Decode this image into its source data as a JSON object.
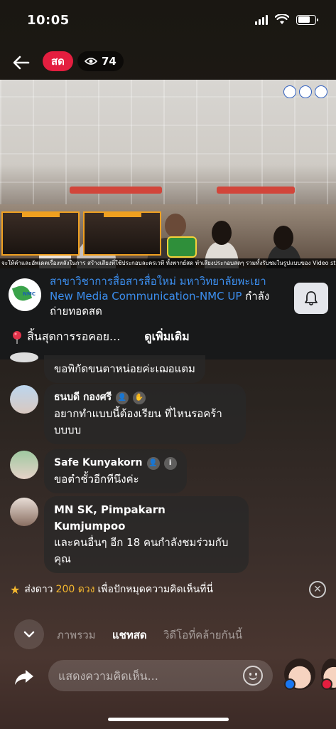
{
  "status_bar": {
    "time": "10:05"
  },
  "header": {
    "live_label": "สด",
    "viewer_count": "74"
  },
  "video": {
    "ticker_text": "จะให้คำและอัพเดตเรื่องหลังในการ สร้างเสียงที่ใช้ประกอบละครเวที ทั้งพากย์สด ทำเสียงประกอบสดๆ รวมทั้งรับชมในรูปแบบของ Video streaming"
  },
  "page_info": {
    "page_name": "สาขาวิชาการสื่อสารสื่อใหม่ มหาวิทยาลัยพะเยา New Media Communication-NMC UP",
    "suffix": " กำลังถ่ายทอดสด",
    "avatar_text": "NMC",
    "status_text": "สิ้นสุดการรอคอย...",
    "see_more_label": "ดูเพิ่มเติม"
  },
  "comments": [
    {
      "name": "",
      "text": "ขอพิกัดขนตาหน่อยค่ะเฌอแตม"
    },
    {
      "name": "ธนบดี กองศรี",
      "text": "อยากทำแบบนี้ต้องเรียน ที่ไหนรอคร้าบบบบ"
    },
    {
      "name": "Safe Kunyakorn",
      "text": "ขอตำชั้วอีกทีนึงค่ะ"
    },
    {
      "name": "MN SK, Pimpakarn Kumjumpoo",
      "text": "และคนอื่นๆ อีก 18 คนกำลังชมร่วมกับคุณ"
    }
  ],
  "star_banner": {
    "prefix": "ส่งดาว",
    "highlight": "200 ดวง",
    "suffix": "เพื่อปักหมุดความคิดเห็นที่นี่"
  },
  "tabs": [
    {
      "label": "ภาพรวม"
    },
    {
      "label": "แชทสด"
    },
    {
      "label": "วิดีโอที่คล้ายกันนี้"
    }
  ],
  "composer": {
    "placeholder": "แสดงความคิดเห็น..."
  },
  "colors": {
    "live_red": "#e41e3f",
    "link_blue": "#3c8ff0",
    "star_yellow": "#f5b82e"
  }
}
